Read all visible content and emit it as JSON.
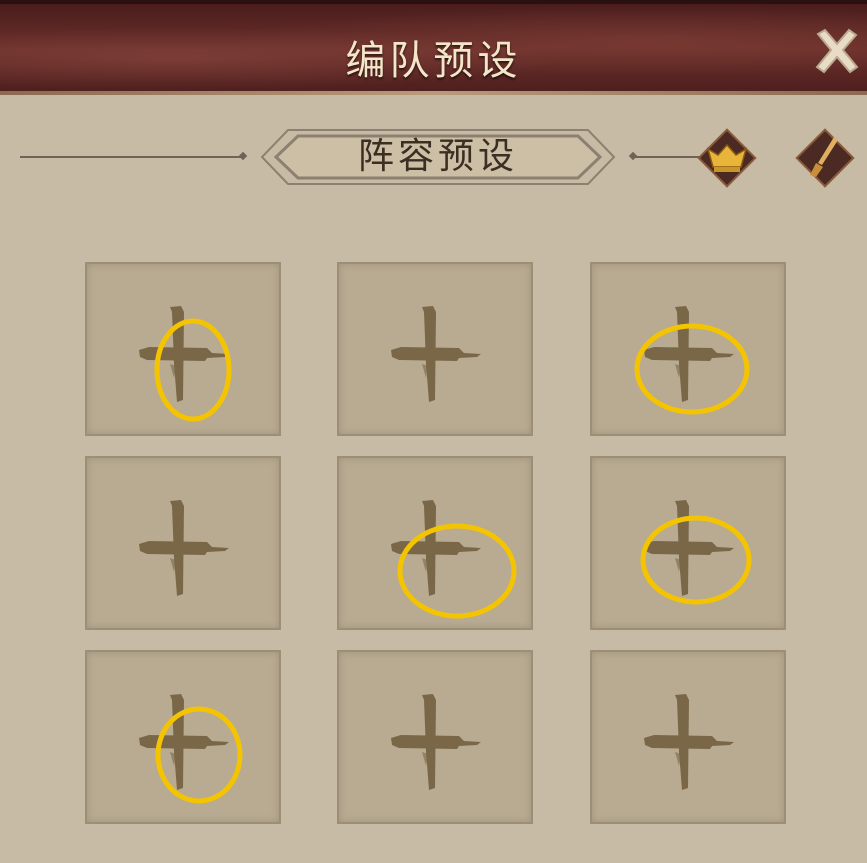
{
  "header": {
    "title": "编队预设",
    "close_icon": "close-x-icon"
  },
  "section": {
    "banner_label": "阵容预设",
    "buttons": [
      {
        "name": "crown-emblem-icon"
      },
      {
        "name": "brush-emblem-icon"
      }
    ]
  },
  "slots": [
    {
      "state": "empty",
      "icon": "add-plus-icon",
      "highlighted": true
    },
    {
      "state": "empty",
      "icon": "add-plus-icon",
      "highlighted": false
    },
    {
      "state": "empty",
      "icon": "add-plus-icon",
      "highlighted": true
    },
    {
      "state": "empty",
      "icon": "add-plus-icon",
      "highlighted": false
    },
    {
      "state": "empty",
      "icon": "add-plus-icon",
      "highlighted": true
    },
    {
      "state": "empty",
      "icon": "add-plus-icon",
      "highlighted": true
    },
    {
      "state": "empty",
      "icon": "add-plus-icon",
      "highlighted": true
    },
    {
      "state": "empty",
      "icon": "add-plus-icon",
      "highlighted": false
    },
    {
      "state": "empty",
      "icon": "add-plus-icon",
      "highlighted": false
    }
  ],
  "colors": {
    "background": "#c8bba6",
    "slot": "#b9ab92",
    "plus": "#7a6748",
    "highlight_ring": "#f5c400",
    "title_text": "#f4e6c9"
  }
}
